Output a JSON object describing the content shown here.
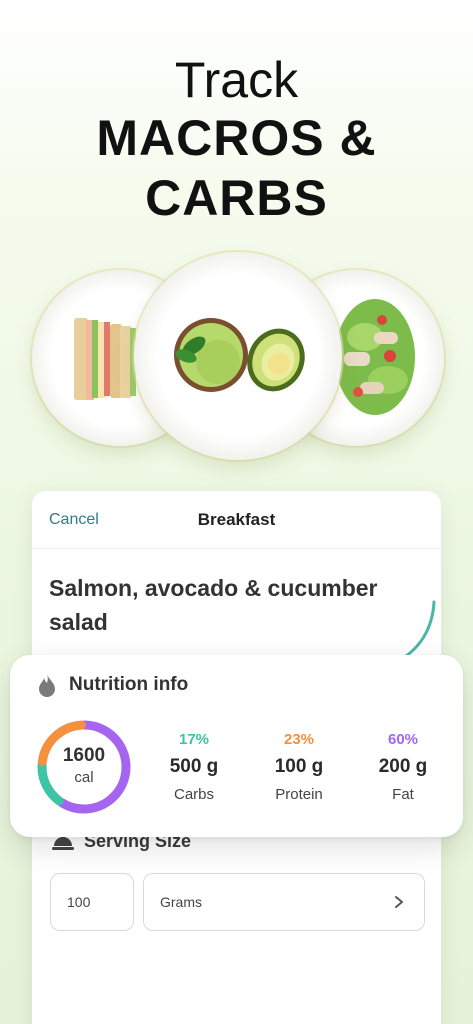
{
  "headline": {
    "line1": "Track",
    "line2": "MACROS &",
    "line3": "CARBS"
  },
  "card": {
    "cancel_label": "Cancel",
    "title": "Breakfast",
    "food_name": "Salmon, avocado & cucumber salad",
    "serving": {
      "label": "Serving Size",
      "quantity": "100",
      "unit": "Grams"
    }
  },
  "nutrition": {
    "title": "Nutrition info",
    "calories_value": "1600",
    "calories_unit": "cal",
    "macros": [
      {
        "percent": "17%",
        "amount": "500 g",
        "label": "Carbs",
        "color": "#3cc4a4"
      },
      {
        "percent": "23%",
        "amount": "100 g",
        "label": "Protein",
        "color": "#f4903e"
      },
      {
        "percent": "60%",
        "amount": "200 g",
        "label": "Fat",
        "color": "#a565f0"
      }
    ]
  },
  "icons": {
    "flame": "flame-icon",
    "cloche": "cloche-icon",
    "chevron": "chevron-right-icon"
  }
}
